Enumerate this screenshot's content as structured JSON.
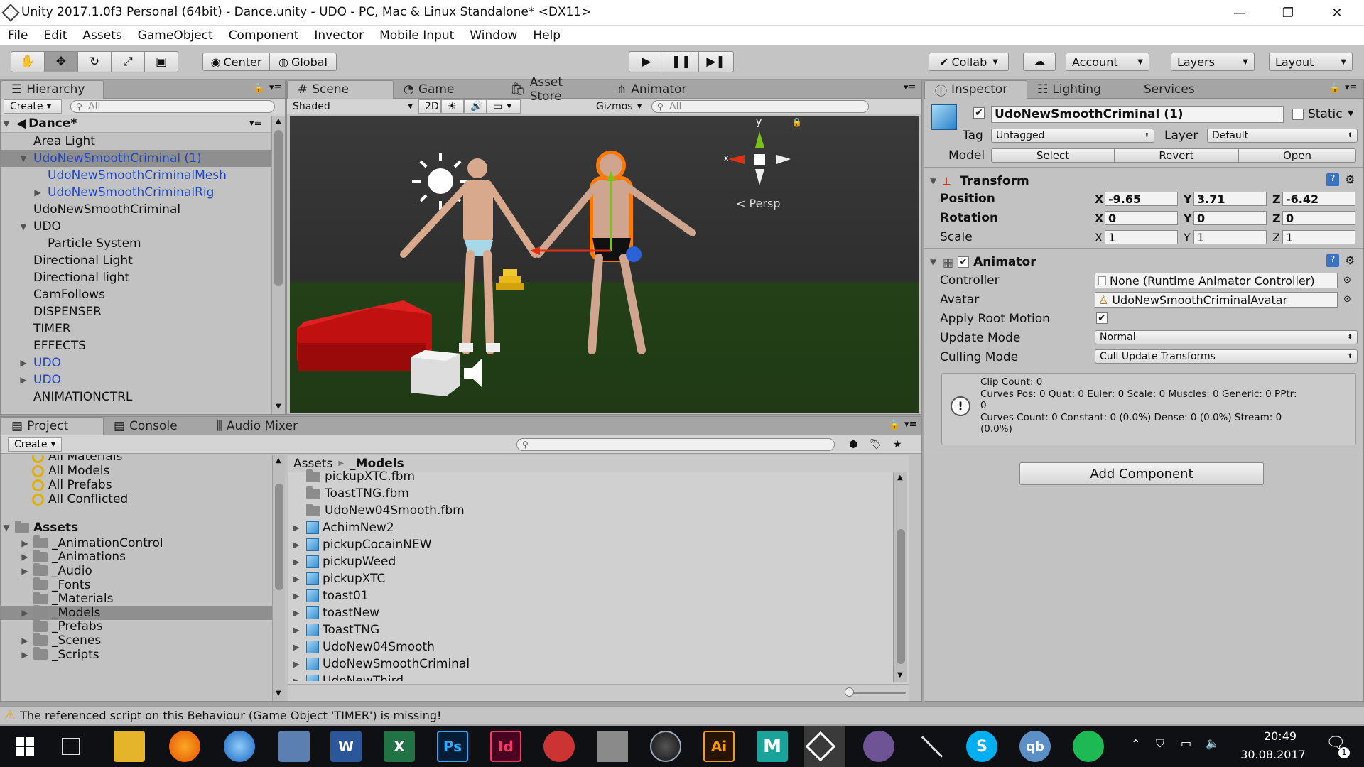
{
  "window": {
    "title": "Unity 2017.1.0f3 Personal (64bit) - Dance.unity - UDO - PC, Mac & Linux Standalone* <DX11>",
    "controls": {
      "minimize": "—",
      "maximize": "❐",
      "close": "✕"
    }
  },
  "menu": [
    "File",
    "Edit",
    "Assets",
    "GameObject",
    "Component",
    "Invector",
    "Mobile Input",
    "Window",
    "Help"
  ],
  "toolbar": {
    "pivot": "Center",
    "space": "Global",
    "collab": "Collab",
    "account": "Account",
    "layers": "Layers",
    "layout": "Layout"
  },
  "hierarchy": {
    "tab": "Hierarchy",
    "create": "Create",
    "search_placeholder": "All",
    "scene": "Dance*",
    "items": [
      {
        "label": "Area Light",
        "indent": 1,
        "arrow": "",
        "style": "normal"
      },
      {
        "label": "UdoNewSmoothCriminal (1)",
        "indent": 1,
        "arrow": "▼",
        "style": "selected"
      },
      {
        "label": "UdoNewSmoothCriminalMesh",
        "indent": 2,
        "arrow": "",
        "style": "blue"
      },
      {
        "label": "UdoNewSmoothCriminalRig",
        "indent": 2,
        "arrow": "▶",
        "style": "blue"
      },
      {
        "label": "UdoNewSmoothCriminal",
        "indent": 1,
        "arrow": "",
        "style": "normal"
      },
      {
        "label": "UDO",
        "indent": 1,
        "arrow": "▼",
        "style": "normal"
      },
      {
        "label": "Particle System",
        "indent": 2,
        "arrow": "",
        "style": "normal"
      },
      {
        "label": "Directional Light",
        "indent": 1,
        "arrow": "",
        "style": "normal"
      },
      {
        "label": "Directional light",
        "indent": 1,
        "arrow": "",
        "style": "normal"
      },
      {
        "label": "CamFollows",
        "indent": 1,
        "arrow": "",
        "style": "normal"
      },
      {
        "label": "DISPENSER",
        "indent": 1,
        "arrow": "",
        "style": "normal"
      },
      {
        "label": "TIMER",
        "indent": 1,
        "arrow": "",
        "style": "normal"
      },
      {
        "label": "EFFECTS",
        "indent": 1,
        "arrow": "",
        "style": "normal"
      },
      {
        "label": "UDO",
        "indent": 1,
        "arrow": "▶",
        "style": "blue"
      },
      {
        "label": "UDO",
        "indent": 1,
        "arrow": "▶",
        "style": "blue"
      },
      {
        "label": "ANIMATIONCTRL",
        "indent": 1,
        "arrow": "",
        "style": "normal"
      }
    ]
  },
  "scene": {
    "tabs": [
      "Scene",
      "Game",
      "Asset Store",
      "Animator"
    ],
    "shading": "Shaded",
    "mode2d": "2D",
    "gizmos": "Gizmos",
    "search_placeholder": "All",
    "persp": "Persp",
    "axis_y": "y",
    "axis_x": "x"
  },
  "project": {
    "tabs": [
      "Project",
      "Console",
      "Audio Mixer"
    ],
    "create": "Create",
    "favorites": [
      "All Materials",
      "All Models",
      "All Prefabs",
      "All Conflicted"
    ],
    "assets_root": "Assets",
    "folders": [
      {
        "label": "_AnimationControl",
        "arrow": "▶",
        "selected": false
      },
      {
        "label": "_Animations",
        "arrow": "▶",
        "selected": false
      },
      {
        "label": "_Audio",
        "arrow": "▶",
        "selected": false
      },
      {
        "label": "_Fonts",
        "arrow": "",
        "selected": false
      },
      {
        "label": "_Materials",
        "arrow": "",
        "selected": false
      },
      {
        "label": "_Models",
        "arrow": "▶",
        "selected": true
      },
      {
        "label": "_Prefabs",
        "arrow": "",
        "selected": false
      },
      {
        "label": "_Scenes",
        "arrow": "▶",
        "selected": false
      },
      {
        "label": "_Scripts",
        "arrow": "▶",
        "selected": false
      }
    ],
    "breadcrumb": [
      "Assets",
      "_Models"
    ],
    "files": [
      {
        "label": "pickupXTC.fbm",
        "type": "folder"
      },
      {
        "label": "ToastTNG.fbm",
        "type": "folder"
      },
      {
        "label": "UdoNew04Smooth.fbm",
        "type": "folder"
      },
      {
        "label": "AchimNew2",
        "type": "model"
      },
      {
        "label": "pickupCocainNEW",
        "type": "model"
      },
      {
        "label": "pickupWeed",
        "type": "model"
      },
      {
        "label": "pickupXTC",
        "type": "model"
      },
      {
        "label": "toast01",
        "type": "model"
      },
      {
        "label": "toastNew",
        "type": "model"
      },
      {
        "label": "ToastTNG",
        "type": "model"
      },
      {
        "label": "UdoNew04Smooth",
        "type": "model"
      },
      {
        "label": "UdoNewSmoothCriminal",
        "type": "model"
      },
      {
        "label": "UdoNewThird",
        "type": "model"
      }
    ]
  },
  "inspector": {
    "tabs": [
      "Inspector",
      "Lighting",
      "Services"
    ],
    "object_name": "UdoNewSmoothCriminal (1)",
    "static_label": "Static",
    "tag_label": "Tag",
    "tag_value": "Untagged",
    "layer_label": "Layer",
    "layer_value": "Default",
    "model_label": "Model",
    "model_buttons": [
      "Select",
      "Revert",
      "Open"
    ],
    "transform": {
      "title": "Transform",
      "rows": [
        {
          "label": "Position",
          "x": "-9.65",
          "y": "3.71",
          "z": "-6.42",
          "bold": true
        },
        {
          "label": "Rotation",
          "x": "0",
          "y": "0",
          "z": "0",
          "bold": true
        },
        {
          "label": "Scale",
          "x": "1",
          "y": "1",
          "z": "1",
          "bold": false
        }
      ]
    },
    "animator": {
      "title": "Animator",
      "controller_label": "Controller",
      "controller_value": "None (Runtime Animator Controller)",
      "avatar_label": "Avatar",
      "avatar_value": "UdoNewSmoothCriminalAvatar",
      "root_motion_label": "Apply Root Motion",
      "update_mode_label": "Update Mode",
      "update_mode_value": "Normal",
      "culling_mode_label": "Culling Mode",
      "culling_mode_value": "Cull Update Transforms",
      "info_lines": [
        "Clip Count: 0",
        "Curves Pos: 0 Quat: 0 Euler: 0 Scale: 0 Muscles: 0 Generic: 0 PPtr:",
        "0",
        "Curves Count: 0 Constant: 0 (0.0%) Dense: 0 (0.0%) Stream: 0",
        "(0.0%)"
      ]
    },
    "add_component": "Add Component"
  },
  "status": {
    "message": "The referenced script on this Behaviour (Game Object 'TIMER') is missing!"
  },
  "taskbar": {
    "apps": [
      "Task View",
      "Explorer",
      "Firefox",
      "Thunderbird",
      "Remote",
      "Word",
      "Excel",
      "Photoshop",
      "InDesign",
      "Paint",
      "Gray",
      "Cinema 4D",
      "Illustrator",
      "Maya",
      "Unity",
      "GitHub",
      "Pen",
      "Skype",
      "qBittorrent",
      "Spotify"
    ],
    "labels": {
      "word": "W",
      "excel": "X",
      "ps": "Ps",
      "id": "Id",
      "ai": "Ai",
      "maya": "M",
      "skype": "S",
      "qb": "qb"
    },
    "time": "20:49",
    "date": "30.08.2017",
    "notifications": "1"
  }
}
